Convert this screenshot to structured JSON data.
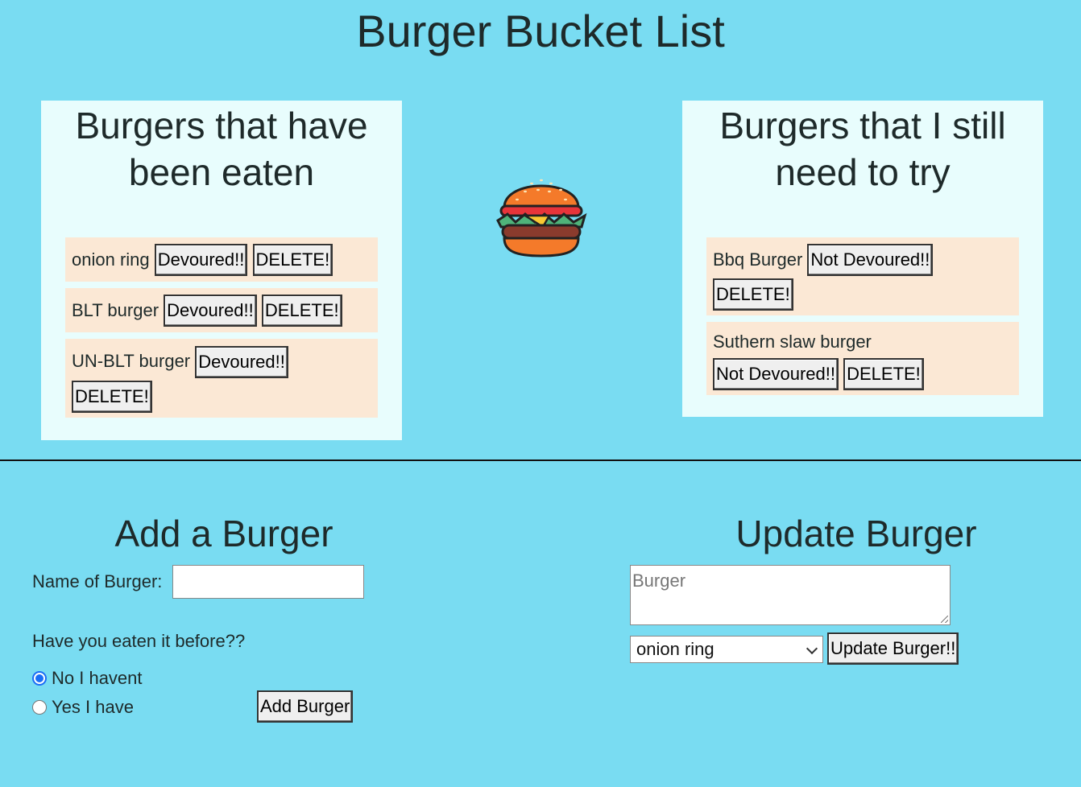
{
  "page": {
    "title": "Burger Bucket List"
  },
  "eaten": {
    "title": "Burgers that have been eaten",
    "items": [
      {
        "name": "onion ring",
        "action_label": "Devoured!!",
        "delete_label": "DELETE!"
      },
      {
        "name": "BLT burger",
        "action_label": "Devoured!!",
        "delete_label": "DELETE!"
      },
      {
        "name": "UN-BLT burger",
        "action_label": "Devoured!!",
        "delete_label": "DELETE!"
      }
    ]
  },
  "to_try": {
    "title": "Burgers that I still need to try",
    "items": [
      {
        "name": "Bbq Burger",
        "action_label": "Not Devoured!!",
        "delete_label": "DELETE!"
      },
      {
        "name": "Suthern slaw burger",
        "action_label": "Not Devoured!!",
        "delete_label": "DELETE!"
      }
    ]
  },
  "add_form": {
    "title": "Add a Burger",
    "name_label": "Name of Burger:",
    "name_value": "",
    "eaten_question": "Have you eaten it before??",
    "options": [
      {
        "label": "No I havent",
        "checked": true
      },
      {
        "label": "Yes I have",
        "checked": false
      }
    ],
    "submit_label": "Add Burger"
  },
  "update_form": {
    "title": "Update Burger",
    "textarea_placeholder": "Burger",
    "selected_burger": "onion ring",
    "submit_label": "Update Burger!!"
  },
  "icons": {
    "burger": "burger-icon"
  },
  "colors": {
    "background": "#79dcf2",
    "card": "#e8fdfd",
    "item": "#fbe8d5",
    "radio_accent": "#1a6ef5"
  }
}
